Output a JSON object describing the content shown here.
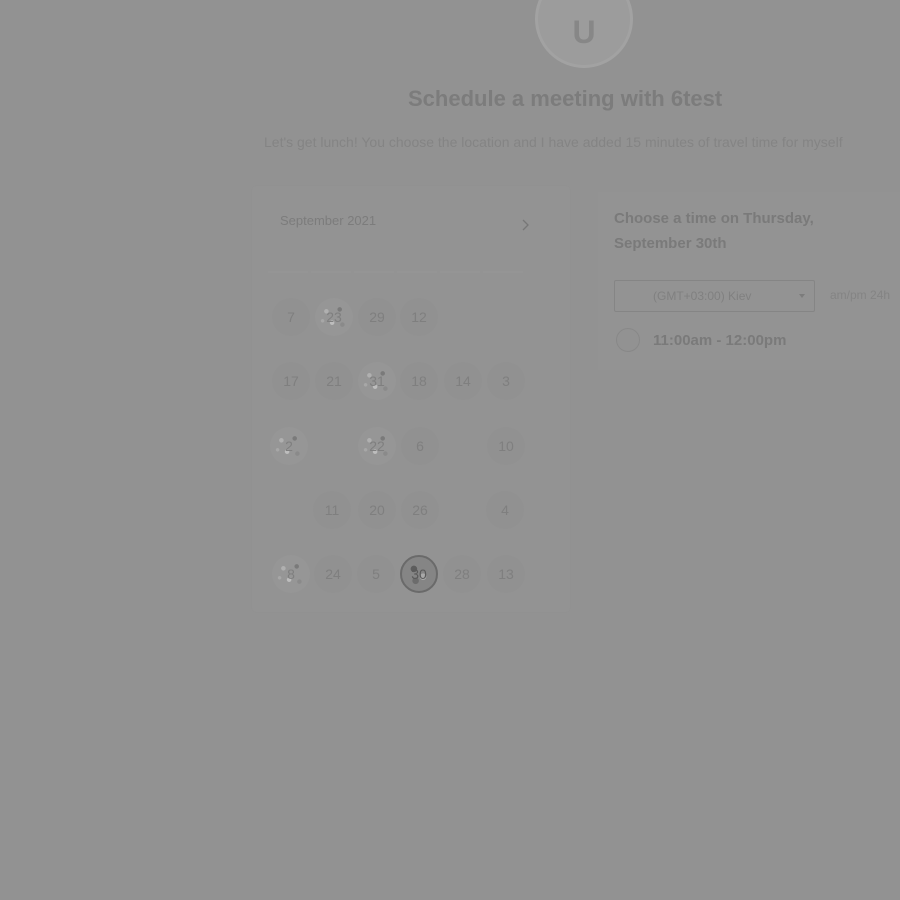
{
  "header": {
    "avatar_letter": "U",
    "title": "Schedule a meeting with 6test",
    "subtitle": "Let's get lunch! You choose the location and I have added 15 minutes of travel time for myself"
  },
  "calendar": {
    "month_label": "September 2021",
    "days": [
      {
        "label": "7"
      },
      {
        "label": "23"
      },
      {
        "label": "29"
      },
      {
        "label": "12"
      },
      {
        "label": "17"
      },
      {
        "label": "21"
      },
      {
        "label": "31"
      },
      {
        "label": "18"
      },
      {
        "label": "14"
      },
      {
        "label": "3"
      },
      {
        "label": "2"
      },
      {
        "label": "22"
      },
      {
        "label": "6"
      },
      {
        "label": "10"
      },
      {
        "label": "11"
      },
      {
        "label": "20"
      },
      {
        "label": "26"
      },
      {
        "label": "4"
      },
      {
        "label": "8"
      },
      {
        "label": "24"
      },
      {
        "label": "5"
      },
      {
        "label": "30",
        "selected": true
      },
      {
        "label": "28"
      },
      {
        "label": "13"
      }
    ]
  },
  "times": {
    "heading": "Choose a time on Thursday, September 30th",
    "timezone": "(GMT+03:00) Kiev",
    "format_ampm": "am/pm",
    "format_24h": "24h",
    "slots": [
      {
        "label": "11:00am - 12:00pm"
      }
    ]
  },
  "icons": {
    "next": "chevron-right-icon",
    "caret": "caret-down-icon"
  }
}
